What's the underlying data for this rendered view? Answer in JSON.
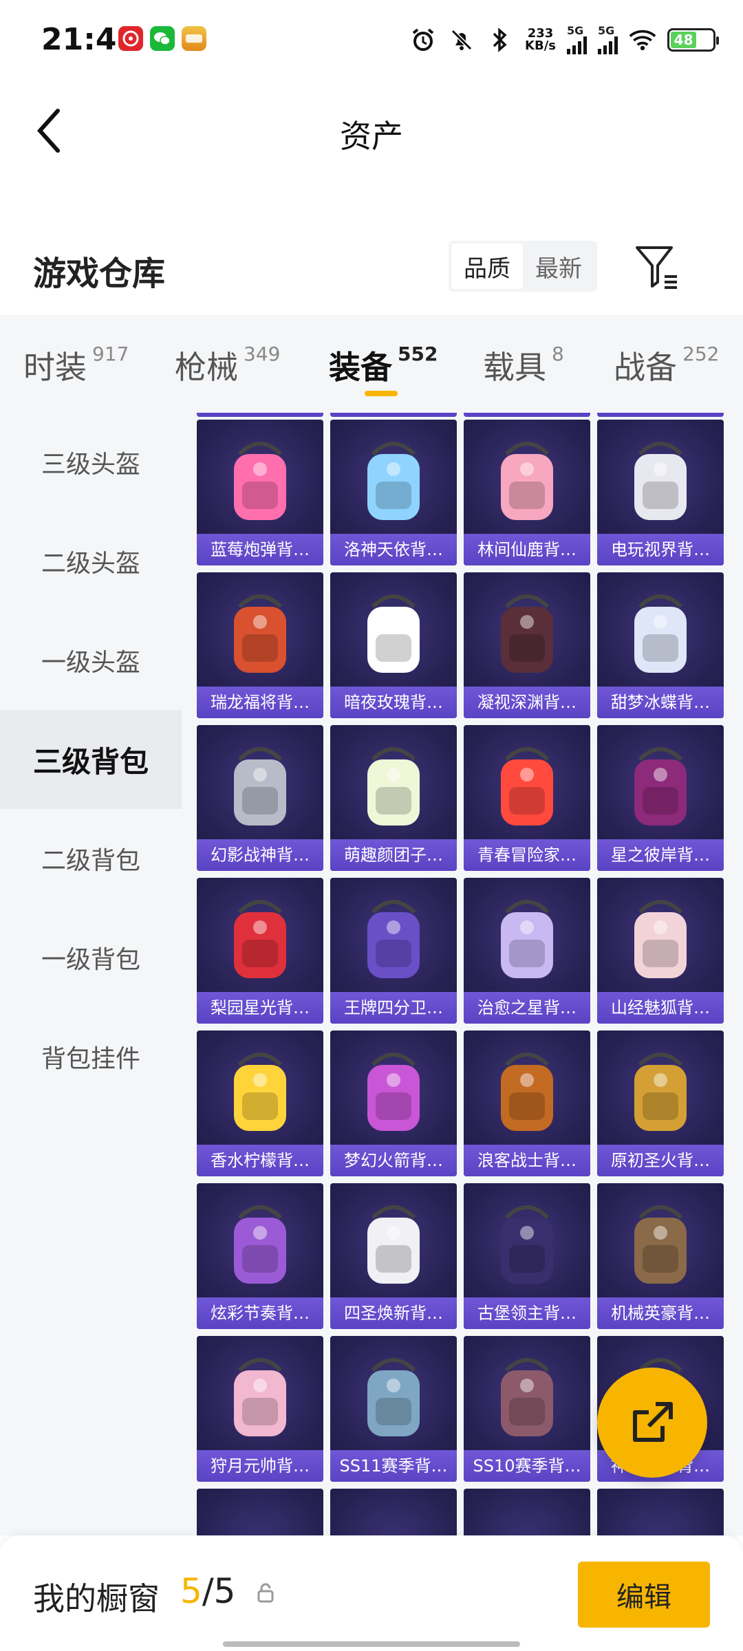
{
  "status_bar": {
    "time": "21:41",
    "net_speed_value": "233",
    "net_speed_unit": "KB/s",
    "sim1": "5G",
    "sim2": "5G",
    "battery": "48",
    "icons": [
      "netease-music-icon",
      "wechat-icon",
      "game-app-icon",
      "alarm-icon",
      "mute-icon",
      "bluetooth-icon",
      "wifi-icon"
    ]
  },
  "header": {
    "title": "资产"
  },
  "warehouse": {
    "title": "游戏仓库",
    "sort_options": [
      "品质",
      "最新"
    ],
    "active_sort": "品质"
  },
  "tabs": [
    {
      "label": "时装",
      "count": "917"
    },
    {
      "label": "枪械",
      "count": "349"
    },
    {
      "label": "装备",
      "count": "552"
    },
    {
      "label": "载具",
      "count": "8"
    },
    {
      "label": "战备",
      "count": "252"
    }
  ],
  "active_tab": "装备",
  "sidebar": {
    "items": [
      "三级头盔",
      "二级头盔",
      "一级头盔",
      "三级背包",
      "二级背包",
      "一级背包",
      "背包挂件"
    ],
    "active": "三级背包"
  },
  "items": [
    "蓝莓炮弹背…",
    "洛神天依背…",
    "林间仙鹿背…",
    "电玩视界背…",
    "瑞龙福将背…",
    "暗夜玫瑰背…",
    "凝视深渊背…",
    "甜梦冰蝶背…",
    "幻影战神背…",
    "萌趣颜团子…",
    "青春冒险家…",
    "星之彼岸背…",
    "梨园星光背…",
    "王牌四分卫…",
    "治愈之星背…",
    "山经魅狐背…",
    "香水柠檬背…",
    "梦幻火箭背…",
    "浪客战士背…",
    "原初圣火背…",
    "炫彩节奏背…",
    "四圣焕新背…",
    "古堡领主背…",
    "机械英豪背…",
    "狩月元帅背…",
    "SS11赛季背…",
    "SS10赛季背…",
    "神秘秘密背…"
  ],
  "colors": {
    "accent": "#f7b500",
    "card_bg": "#262152",
    "card_caption": "#5a43c4"
  },
  "bottom": {
    "showcase_label": "我的橱窗",
    "showcase_current": "5",
    "showcase_sep": "/",
    "showcase_total": "5",
    "edit_label": "编辑"
  }
}
